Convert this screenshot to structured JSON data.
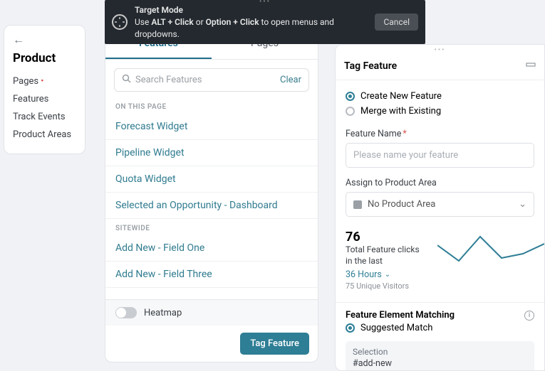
{
  "topbar": {
    "title": "Target Mode",
    "instruction_pre": "Use ",
    "instruction_b1": "ALT + Click",
    "instruction_mid": " or ",
    "instruction_b2": "Option + Click",
    "instruction_post": " to open menus and dropdowns.",
    "cancel": "Cancel"
  },
  "sidebar": {
    "title": "Product",
    "items": [
      {
        "label": "Pages",
        "dot": true
      },
      {
        "label": "Features",
        "dot": false
      },
      {
        "label": "Track Events",
        "dot": false
      },
      {
        "label": "Product Areas",
        "dot": false
      }
    ]
  },
  "middle": {
    "tabs": {
      "features": "Features",
      "pages": "Pages"
    },
    "search_placeholder": "Search Features",
    "clear": "Clear",
    "section_on_page": "ON THIS PAGE",
    "on_page_items": [
      "Forecast Widget",
      "Pipeline Widget",
      "Quota Widget",
      "Selected an Opportunity - Dashboard"
    ],
    "section_sitewide": "SITEWIDE",
    "sitewide_items": [
      "Add New - Field One",
      "Add New - Field Three"
    ],
    "heatmap": "Heatmap",
    "tag_feature": "Tag Feature"
  },
  "right": {
    "title": "Tag Feature",
    "radio_create": "Create New Feature",
    "radio_merge": "Merge with Existing",
    "feature_name_label": "Feature Name",
    "feature_name_placeholder": "Please name your feature",
    "assign_label": "Assign to Product Area",
    "assign_value": "No Product Area",
    "stat_value": "76",
    "stat_line1": "Total Feature clicks",
    "stat_line2": "in the last",
    "stat_link": "36 Hours",
    "stat_unique": "75 Unique Visitors",
    "matching_title": "Feature Element Matching",
    "suggested": "Suggested Match",
    "selection_label": "Selection",
    "selection_value": "#add-new"
  },
  "chart_data": {
    "type": "line",
    "x": [
      0,
      1,
      2,
      3,
      4,
      5
    ],
    "values": [
      52,
      25,
      58,
      30,
      35,
      50
    ],
    "ylim": [
      0,
      76
    ]
  }
}
